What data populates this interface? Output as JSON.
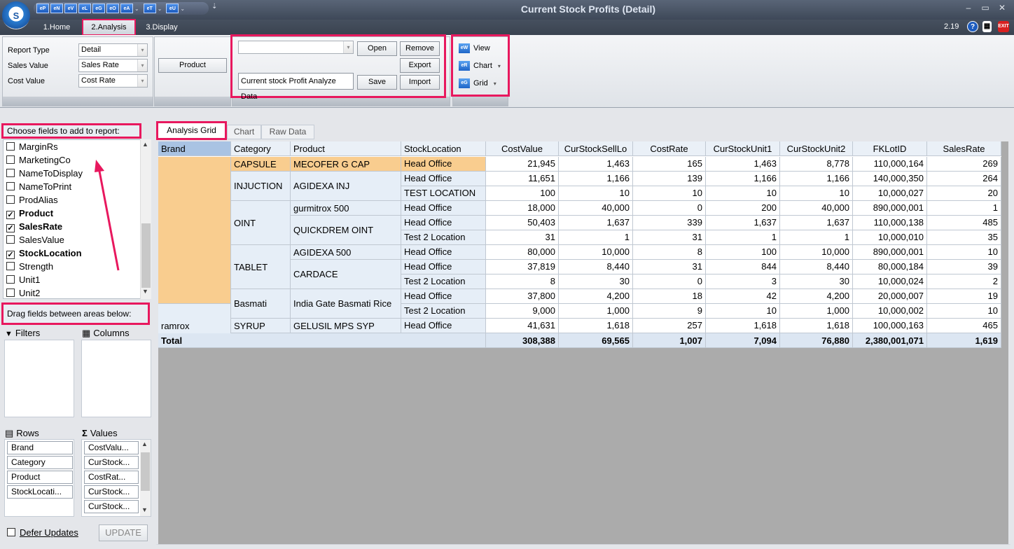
{
  "window": {
    "title": "Current Stock Profits (Detail)",
    "logo_letter": "S",
    "version": "2.19"
  },
  "quick_access": [
    {
      "icon": "eP"
    },
    {
      "icon": "eN"
    },
    {
      "icon": "eV"
    },
    {
      "icon": "eL"
    },
    {
      "icon": "eG"
    },
    {
      "icon": "eO"
    },
    {
      "icon": "eA"
    },
    {
      "icon": "eT"
    },
    {
      "icon": "eU"
    }
  ],
  "ribbon_tabs": [
    "1.Home",
    "2.Analysis",
    "3.Display"
  ],
  "report": {
    "report_type_label": "Report Type",
    "report_type_value": "Detail",
    "sales_value_label": "Sales Value",
    "sales_value_value": "Sales Rate",
    "cost_value_label": "Cost Value",
    "cost_value_value": "Cost Rate",
    "product_button": "Product"
  },
  "layout_group": {
    "combo_value": "",
    "name_value": "Current stock Profit Analyze Data",
    "open": "Open",
    "remove": "Remove",
    "export": "Export",
    "save": "Save",
    "import": "Import"
  },
  "view_group": {
    "view": "View",
    "chart": "Chart",
    "grid": "Grid",
    "view_icon": "eW",
    "chart_icon": "eR",
    "grid_icon": "eG"
  },
  "field_list": {
    "title": "Choose fields to add to report:",
    "items": [
      {
        "label": "MarginRs",
        "checked": false
      },
      {
        "label": "MarketingCo",
        "checked": false
      },
      {
        "label": "NameToDisplay",
        "checked": false
      },
      {
        "label": "NameToPrint",
        "checked": false
      },
      {
        "label": "ProdAlias",
        "checked": false
      },
      {
        "label": "Product",
        "checked": true
      },
      {
        "label": "SalesRate",
        "checked": true
      },
      {
        "label": "SalesValue",
        "checked": false
      },
      {
        "label": "StockLocation",
        "checked": true
      },
      {
        "label": "Strength",
        "checked": false
      },
      {
        "label": "Unit1",
        "checked": false
      },
      {
        "label": "Unit2",
        "checked": false
      }
    ]
  },
  "areas": {
    "title": "Drag fields between areas below:",
    "filters": "Filters",
    "columns": "Columns",
    "rows": "Rows",
    "values": "Values",
    "rows_items": [
      "Brand",
      "Category",
      "Product",
      "StockLocati..."
    ],
    "values_items": [
      "CostValu...",
      "CurStock...",
      "CostRat...",
      "CurStock...",
      "CurStock..."
    ],
    "defer": "Defer Updates",
    "update": "UPDATE"
  },
  "grid_tabs": [
    "Analysis Grid",
    "Chart",
    "Raw Data"
  ],
  "pivot": {
    "headers": [
      "Brand",
      "Category",
      "Product",
      "StockLocation",
      "CostValue",
      "CurStockSellLo",
      "CostRate",
      "CurStockUnit1",
      "CurStockUnit2",
      "FKLotID",
      "SalesRate"
    ],
    "brand_groups": [
      {
        "label": "",
        "rows": 10
      },
      {
        "label": "ramrox",
        "rows": 3
      }
    ],
    "categories": [
      {
        "label": "CAPSULE",
        "start": 0,
        "rows": 1
      },
      {
        "label": "INJUCTION",
        "start": 1,
        "rows": 2
      },
      {
        "label": "OINT",
        "start": 3,
        "rows": 3
      },
      {
        "label": "TABLET",
        "start": 6,
        "rows": 3
      },
      {
        "label": "Basmati",
        "start": 9,
        "rows": 2
      },
      {
        "label": "SYRUP",
        "start": 11,
        "rows": 1
      }
    ],
    "products": [
      {
        "label": "MECOFER G CAP",
        "start": 0,
        "rows": 1
      },
      {
        "label": "AGIDEXA INJ",
        "start": 1,
        "rows": 2
      },
      {
        "label": "gurmitrox 500",
        "start": 3,
        "rows": 1
      },
      {
        "label": "QUICKDREM OINT",
        "start": 4,
        "rows": 2
      },
      {
        "label": "AGIDEXA 500",
        "start": 6,
        "rows": 1
      },
      {
        "label": "CARDACE",
        "start": 7,
        "rows": 2
      },
      {
        "label": "India Gate Basmati Rice",
        "start": 9,
        "rows": 2
      },
      {
        "label": "GELUSIL MPS SYP",
        "start": 11,
        "rows": 1
      }
    ],
    "rows": [
      {
        "loc": "Head Office",
        "v": [
          "21,945",
          "1,463",
          "165",
          "1,463",
          "8,778",
          "110,000,164",
          "269"
        ]
      },
      {
        "loc": "Head Office",
        "v": [
          "11,651",
          "1,166",
          "139",
          "1,166",
          "1,166",
          "140,000,350",
          "264"
        ]
      },
      {
        "loc": "TEST LOCATION",
        "v": [
          "100",
          "10",
          "10",
          "10",
          "10",
          "10,000,027",
          "20"
        ]
      },
      {
        "loc": "Head Office",
        "v": [
          "18,000",
          "40,000",
          "0",
          "200",
          "40,000",
          "890,000,001",
          "1"
        ]
      },
      {
        "loc": "Head Office",
        "v": [
          "50,403",
          "1,637",
          "339",
          "1,637",
          "1,637",
          "110,000,138",
          "485"
        ]
      },
      {
        "loc": "Test 2 Location",
        "v": [
          "31",
          "1",
          "31",
          "1",
          "1",
          "10,000,010",
          "35"
        ]
      },
      {
        "loc": "Head Office",
        "v": [
          "80,000",
          "10,000",
          "8",
          "100",
          "10,000",
          "890,000,001",
          "10"
        ]
      },
      {
        "loc": "Head Office",
        "v": [
          "37,819",
          "8,440",
          "31",
          "844",
          "8,440",
          "80,000,184",
          "39"
        ]
      },
      {
        "loc": "Test 2 Location",
        "v": [
          "8",
          "30",
          "0",
          "3",
          "30",
          "10,000,024",
          "2"
        ]
      },
      {
        "loc": "Head Office",
        "v": [
          "37,800",
          "4,200",
          "18",
          "42",
          "4,200",
          "20,000,007",
          "19"
        ]
      },
      {
        "loc": "Test 2 Location",
        "v": [
          "9,000",
          "1,000",
          "9",
          "10",
          "1,000",
          "10,000,002",
          "10"
        ]
      },
      {
        "loc": "Head Office",
        "v": [
          "41,631",
          "1,618",
          "257",
          "1,618",
          "1,618",
          "100,000,163",
          "465"
        ]
      }
    ],
    "total_label": "Total",
    "totals": [
      "308,388",
      "69,565",
      "1,007",
      "7,094",
      "76,880",
      "2,380,001,071",
      "1,619"
    ]
  },
  "colors": {
    "highlight": "#e8185e",
    "selected": "#f9cd8f",
    "header": "#eaf0f7",
    "row_header": "#e6eef7",
    "total": "#dce6f2"
  }
}
